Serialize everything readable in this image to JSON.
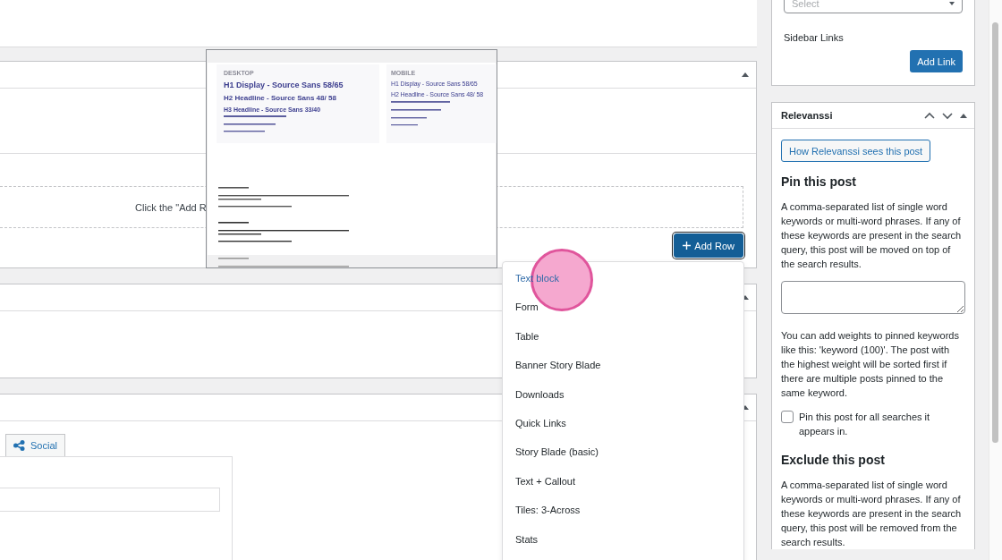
{
  "layout_builder": {
    "empty_message": "Click the \"Add R",
    "add_row_button": "Add Row"
  },
  "layout_preview": {
    "desktop_label": "DESKTOP",
    "mobile_label": "MOBILE",
    "desktop_headings": [
      "H1 Display - Source Sans 58/65",
      "H2 Headline - Source Sans 48/ 58",
      "H3 Headline - Source Sans 33/40"
    ],
    "mobile_headings": [
      "H1 Display - Source Sans 58/65",
      "H2 Headline - Source Sans 48/ 58"
    ]
  },
  "row_menu": {
    "items": [
      {
        "label": "Text block",
        "selected": true
      },
      {
        "label": "Form",
        "selected": false
      },
      {
        "label": "Table",
        "selected": false
      },
      {
        "label": "Banner Story Blade",
        "selected": false
      },
      {
        "label": "Downloads",
        "selected": false
      },
      {
        "label": "Quick Links",
        "selected": false
      },
      {
        "label": "Story Blade (basic)",
        "selected": false
      },
      {
        "label": "Text + Callout",
        "selected": false
      },
      {
        "label": "Tiles: 3-Across",
        "selected": false
      },
      {
        "label": "Stats",
        "selected": false
      }
    ]
  },
  "tabs": [
    {
      "label": "Social",
      "selected": false
    }
  ],
  "sidebar": {
    "select_placeholder": "Select",
    "sidebar_links_label": "Sidebar Links",
    "add_link_button": "Add Link"
  },
  "relevanssi": {
    "title": "Relevanssi",
    "preview_button": "How Relevanssi sees this post",
    "pin_heading": "Pin this post",
    "pin_description": "A comma-separated list of single word keywords or multi-word phrases. If any of these keywords are present in the search query, this post will be moved on top of the search results.",
    "pin_weights_note": "You can add weights to pinned keywords like this: 'keyword (100)'. The post with the highest weight will be sorted first if there are multiple posts pinned to the same keyword.",
    "pin_all": {
      "label": "Pin this post for all searches it appears in.",
      "checked": false
    },
    "exclude_heading": "Exclude this post",
    "exclude_description": "A comma-separated list of single word keywords or multi-word phrases. If any of these keywords are present in the search query, this post will be removed from the search results."
  }
}
